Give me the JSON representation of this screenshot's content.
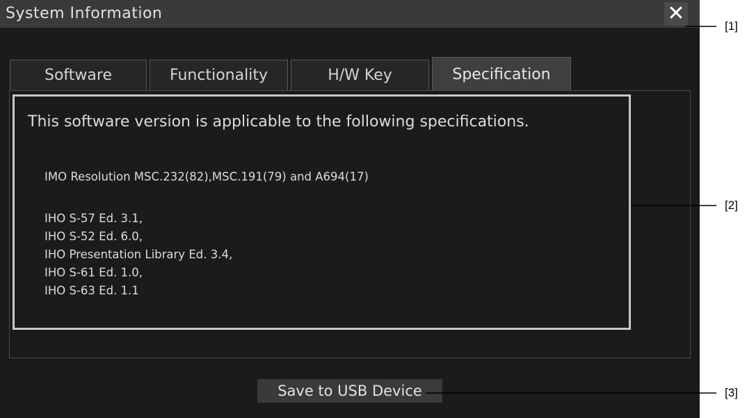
{
  "window": {
    "title": "System Information",
    "close_icon": "close-icon"
  },
  "tabs": [
    {
      "label": "Software",
      "active": false
    },
    {
      "label": "Functionality",
      "active": false
    },
    {
      "label": "H/W Key",
      "active": false
    },
    {
      "label": "Specification",
      "active": true
    }
  ],
  "spec": {
    "heading": "This software version is applicable to the following specifications.",
    "imo_line": "IMO Resolution MSC.232(82),MSC.191(79) and A694(17)",
    "iho_lines": [
      "IHO S-57 Ed. 3.1,",
      "IHO S-52 Ed. 6.0,",
      "IHO Presentation Library Ed. 3.4,",
      "IHO S-61 Ed. 1.0,",
      "IHO S-63 Ed. 1.1"
    ]
  },
  "footer": {
    "save_label": "Save to USB Device"
  },
  "callouts": [
    "[1]",
    "[2]",
    "[3]"
  ],
  "colors": {
    "window_bg": "#1b1b1b",
    "titlebar_bg": "#3a3a3a",
    "active_tab_bg": "#3f3f3f",
    "spec_border": "#c8c8c8"
  }
}
